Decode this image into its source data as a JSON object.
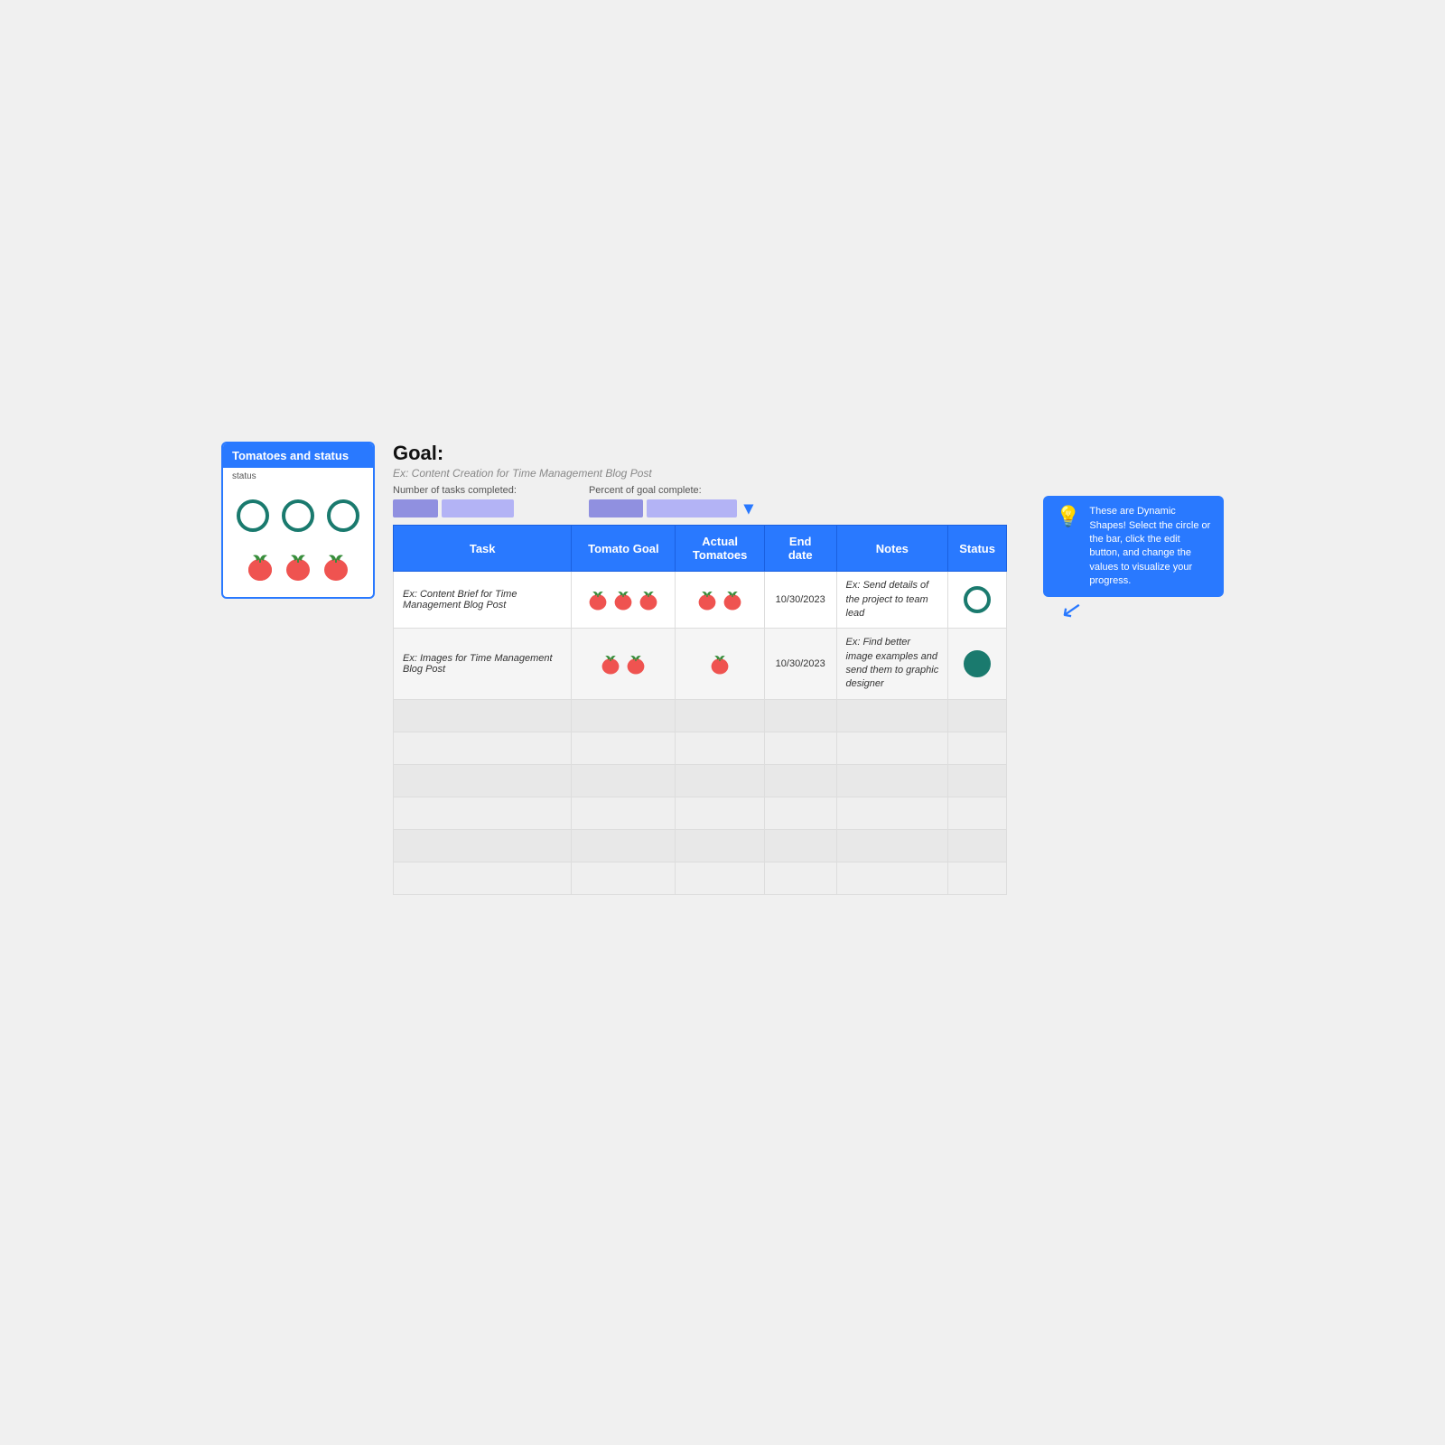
{
  "legend": {
    "header": "Tomatoes and status",
    "subtext": "status",
    "rings": [
      "dark",
      "medium",
      "light"
    ],
    "tomato_rows": [
      [
        "tomato",
        "tomato"
      ],
      [
        "tomato"
      ]
    ]
  },
  "goal": {
    "label": "Goal:",
    "subtitle": "Ex: Content Creation for Time Management Blog Post"
  },
  "progress": {
    "tasks_label": "Number of tasks completed:",
    "percent_label": "Percent of goal complete:"
  },
  "table": {
    "headers": [
      "Task",
      "Tomato Goal",
      "Actual Tomatoes",
      "End date",
      "Notes",
      "Status"
    ],
    "rows": [
      {
        "task": "Ex: Content Brief for Time Management Blog Post",
        "tomato_goal": 3,
        "actual_tomatoes": 2,
        "end_date": "10/30/2023",
        "notes": "Ex: Send details of the project to team lead",
        "status": "ring"
      },
      {
        "task": "Ex: Images for Time Management Blog Post",
        "tomato_goal": 2,
        "actual_tomatoes": 1,
        "end_date": "10/30/2023",
        "notes": "Ex: Find better image examples and send them to graphic designer",
        "status": "ring-filled"
      }
    ],
    "empty_rows": 6
  },
  "hint": {
    "text": "These are Dynamic Shapes! Select the circle or the bar, click the edit button, and change the values to visualize your progress."
  },
  "colors": {
    "blue": "#2979ff",
    "teal": "#1a7a6e",
    "progress_bar": "#b3b3f5",
    "empty_row": "#e8e8e8"
  }
}
